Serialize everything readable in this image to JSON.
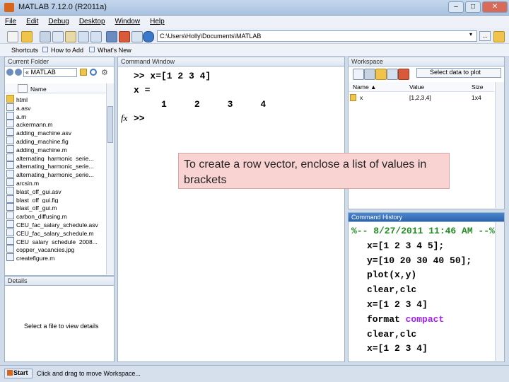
{
  "window": {
    "title": "MATLAB 7.12.0 (R2011a)",
    "controls": [
      "–",
      "□",
      "✕"
    ]
  },
  "menu": [
    "File",
    "Edit",
    "Debug",
    "Desktop",
    "Window",
    "Help"
  ],
  "toolbar": {
    "current_folder_path": "C:\\Users\\Holly\\Documents\\MATLAB",
    "browse_label": "...",
    "dropdown_glyph": "▾"
  },
  "shortcuts": {
    "label": "Shortcuts",
    "items": [
      "How to Add",
      "What's New"
    ]
  },
  "current_folder": {
    "title": "Current Folder",
    "nav_path": "« MATLAB",
    "column_header": "Name",
    "files": [
      {
        "name": "html",
        "type": "folder"
      },
      {
        "name": "a.asv",
        "type": "file"
      },
      {
        "name": "a.m",
        "type": "file"
      },
      {
        "name": "ackermann.m",
        "type": "file"
      },
      {
        "name": "adding_machine.asv",
        "type": "file"
      },
      {
        "name": "adding_machine.fig",
        "type": "file"
      },
      {
        "name": "adding_machine.m",
        "type": "file"
      },
      {
        "name": "alternating_harmonic_serie...",
        "type": "file"
      },
      {
        "name": "alternating_harmonic_serie...",
        "type": "file"
      },
      {
        "name": "alternating_harmonic_serie...",
        "type": "file"
      },
      {
        "name": "arcsin.m",
        "type": "file"
      },
      {
        "name": "blast_off_gui.asv",
        "type": "file"
      },
      {
        "name": "blast_off_gui.fig",
        "type": "file"
      },
      {
        "name": "blast_off_gui.m",
        "type": "file"
      },
      {
        "name": "carbon_diffusing.m",
        "type": "file"
      },
      {
        "name": "CEU_fac_salary_schedule.asv",
        "type": "file"
      },
      {
        "name": "CEU_fac_salary_schedule.m",
        "type": "file"
      },
      {
        "name": "CEU_salary_schedule_2008...",
        "type": "file"
      },
      {
        "name": "copper_vacancies.jpg",
        "type": "file"
      },
      {
        "name": "createfigure.m",
        "type": "file"
      }
    ]
  },
  "details": {
    "title": "Details",
    "message": "Select a file to view details"
  },
  "command_window": {
    "title": "Command Window",
    "lines": [
      ">> x=[1 2 3 4]",
      "x =",
      "     1     2     3     4"
    ],
    "fx_label": "fx",
    "prompt": ">>"
  },
  "callout": {
    "text": "To create a row vector, enclose a list of values in brackets"
  },
  "workspace": {
    "title": "Workspace",
    "select_plot_label": "Select data to plot",
    "columns": [
      "Name ▲",
      "Value",
      "Size"
    ],
    "rows": [
      {
        "name": "x",
        "value": "[1,2,3,4]",
        "size": "1x4"
      }
    ]
  },
  "command_history": {
    "title": "Command History",
    "lines": [
      {
        "text": "%-- 8/27/2011 11:46 AM --%",
        "color": "#228b22"
      },
      {
        "text": "x=[1 2 3 4 5];",
        "color": "#000000"
      },
      {
        "text": "y=[10 20 30 40 50];",
        "color": "#000000"
      },
      {
        "text": "plot(x,y)",
        "color": "#000000"
      },
      {
        "text": "clear,clc",
        "color": "#000000"
      },
      {
        "text": "x=[1 2 3 4]",
        "color": "#000000"
      },
      {
        "text": "format compact",
        "color": "#000000",
        "keyword": "compact",
        "keyword_color": "#a020f0"
      },
      {
        "text": "clear,clc",
        "color": "#000000"
      },
      {
        "text": "x=[1 2 3 4]",
        "color": "#000000"
      }
    ]
  },
  "status": {
    "start_label": "Start",
    "message": "Click and drag to move Workspace..."
  },
  "colors": {
    "accent": "#d8661a",
    "history_comment": "#228b22",
    "history_keyword": "#a020f0",
    "callout_bg": "#f9d3d2"
  }
}
